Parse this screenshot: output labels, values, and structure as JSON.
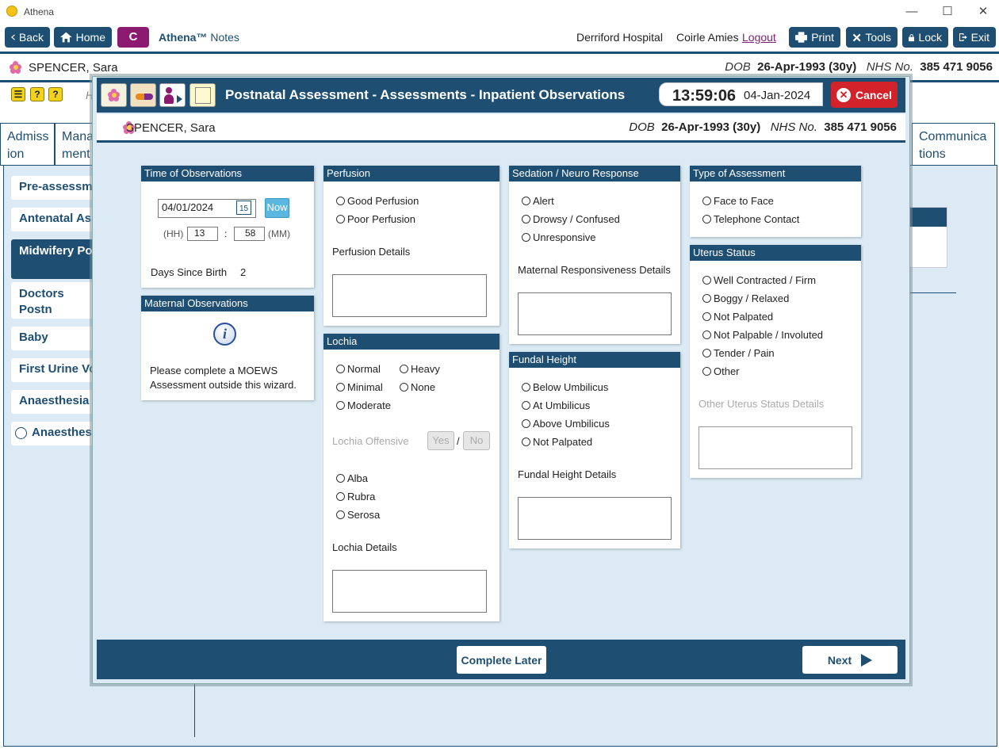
{
  "window": {
    "title": "Athena",
    "minimize": "—",
    "maximize": "☐",
    "close": "✕"
  },
  "toolbar": {
    "back": "Back",
    "home": "Home",
    "c": "C",
    "brand": "Athena™",
    "brand_sub": "Notes",
    "hospital": "Derriford Hospital",
    "user": "Coirle Amies",
    "logout": "Logout",
    "print": "Print",
    "tools": "Tools",
    "lock": "Lock",
    "exit": "Exit"
  },
  "patient": {
    "name": "SPENCER, Sara",
    "dob_label": "DOB",
    "dob": "26-Apr-1993 (30y)",
    "nhs_label": "NHS No.",
    "nhs": "385 471 9056"
  },
  "background": {
    "h_label": "H",
    "tabs": [
      "Admiss ion",
      "Mana ment",
      "Communica tions"
    ],
    "side_items": [
      "Pre-assessmen",
      "Antenatal Ass",
      "Midwifery Pos Assessments",
      "Doctors Postn Assessments",
      "Baby",
      "First Urine Voi",
      "Anaesthesia In",
      "Anaesthesia"
    ]
  },
  "modal": {
    "title": "Postnatal Assessment - Assessments - Inpatient Observations",
    "time": "13:59:06",
    "date": "04-Jan-2024",
    "cancel": "Cancel",
    "time_obs": {
      "header": "Time of Observations",
      "date": "04/01/2024",
      "cal_day": "15",
      "now": "Now",
      "hh_label": "(HH)",
      "hh": "13",
      "sep": ":",
      "mm": "58",
      "mm_label": "(MM)",
      "days_label": "Days Since Birth",
      "days": "2"
    },
    "maternal": {
      "header": "Maternal Observations",
      "text": "Please complete a MOEWS Assessment outside this wizard."
    },
    "perfusion": {
      "header": "Perfusion",
      "options": [
        "Good Perfusion",
        "Poor Perfusion"
      ],
      "details": "Perfusion Details"
    },
    "lochia": {
      "header": "Lochia",
      "options_left": [
        "Normal",
        "Minimal",
        "Moderate"
      ],
      "options_right": [
        "Heavy",
        "None"
      ],
      "offensive": "Lochia Offensive",
      "yes": "Yes",
      "slash": "/",
      "no": "No",
      "types": [
        "Alba",
        "Rubra",
        "Serosa"
      ],
      "details": "Lochia Details"
    },
    "sedation": {
      "header": "Sedation / Neuro Response",
      "options": [
        "Alert",
        "Drowsy / Confused",
        "Unresponsive"
      ],
      "details": "Maternal Responsiveness Details"
    },
    "fundal": {
      "header": "Fundal Height",
      "options": [
        "Below Umbilicus",
        "At Umbilicus",
        "Above Umbilicus",
        "Not Palpated"
      ],
      "details": "Fundal Height Details"
    },
    "type": {
      "header": "Type of Assessment",
      "options": [
        "Face to Face",
        "Telephone Contact"
      ]
    },
    "uterus": {
      "header": "Uterus Status",
      "options": [
        "Well Contracted / Firm",
        "Boggy / Relaxed",
        "Not Palpated",
        "Not Palpable / Involuted",
        "Tender / Pain",
        "Other"
      ],
      "details": "Other Uterus Status Details"
    },
    "complete_later": "Complete Later",
    "next": "Next"
  }
}
